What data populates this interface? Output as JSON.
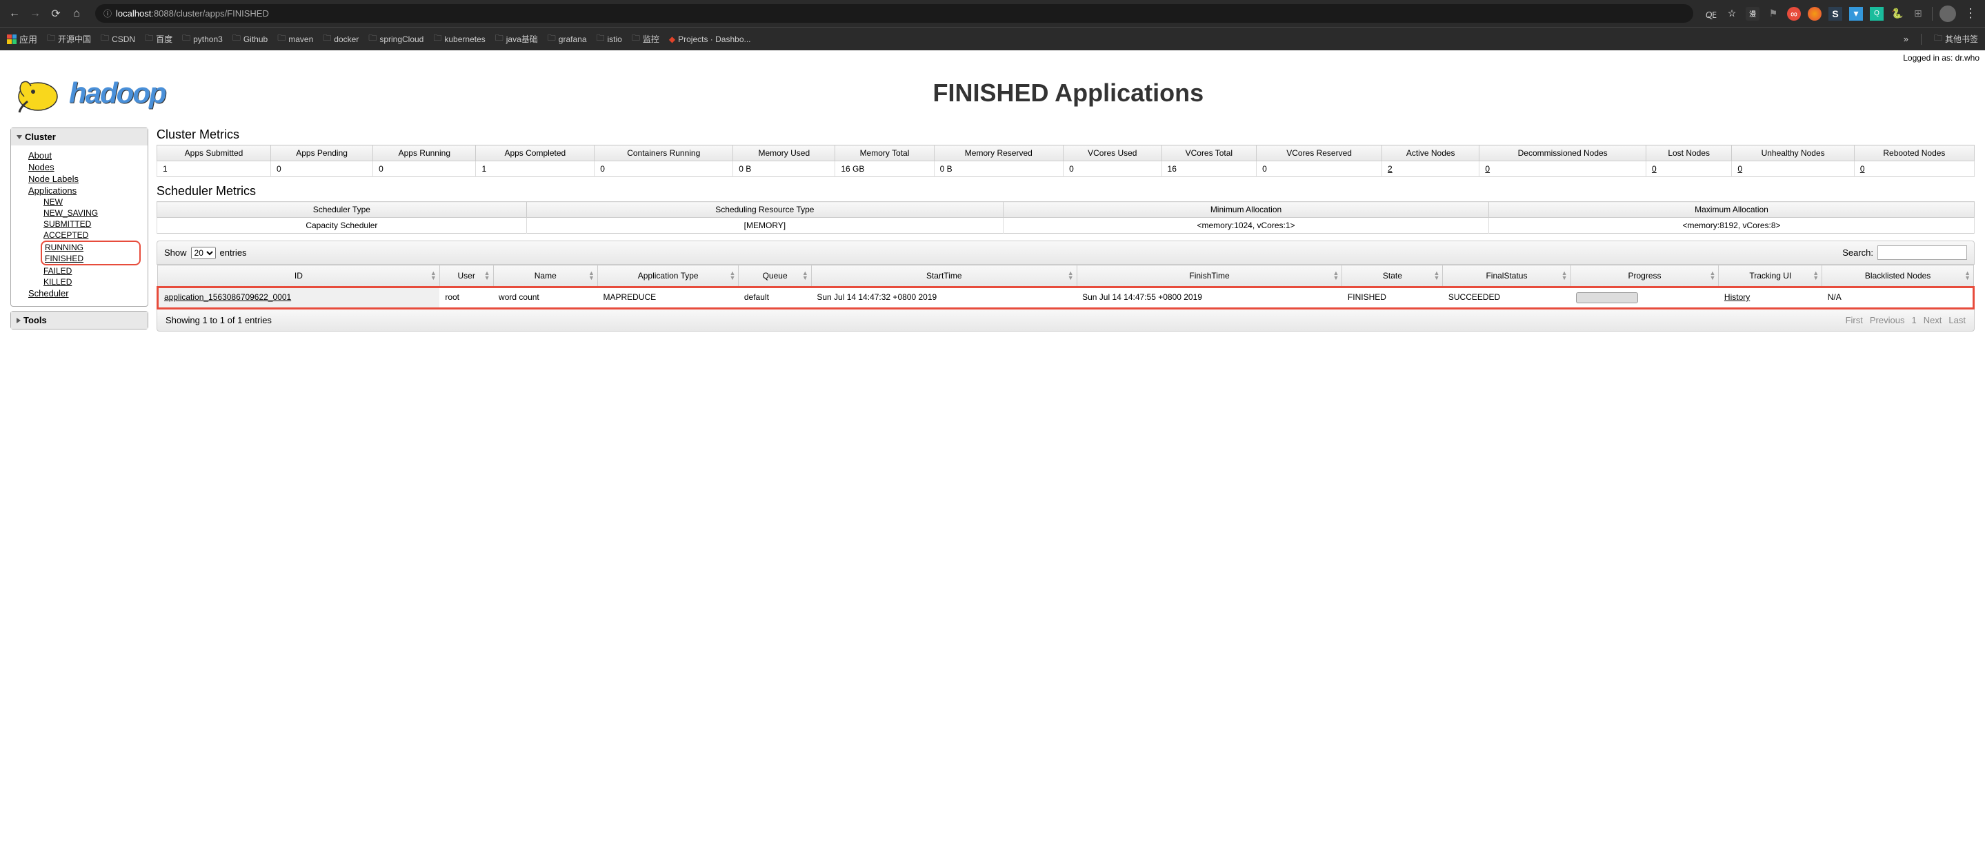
{
  "browser": {
    "url_prefix": "localhost",
    "url_path": ":8088/cluster/apps/FINISHED",
    "bookmarks_apps": "应用",
    "bookmarks": [
      "开源中国",
      "CSDN",
      "百度",
      "python3",
      "Github",
      "maven",
      "docker",
      "springCloud",
      "kubernetes",
      "java基础",
      "grafana",
      "istio",
      "监控"
    ],
    "bookmark_projects": "Projects · Dashbo...",
    "bookmark_other": "其他书签"
  },
  "page": {
    "login_label": "Logged in as: dr.who",
    "logo_text": "hadoop",
    "title": "FINISHED Applications"
  },
  "sidebar": {
    "cluster_header": "Cluster",
    "links": {
      "about": "About",
      "nodes": "Nodes",
      "node_labels": "Node Labels",
      "applications": "Applications",
      "scheduler": "Scheduler"
    },
    "app_states": [
      "NEW",
      "NEW_SAVING",
      "SUBMITTED",
      "ACCEPTED",
      "RUNNING",
      "FINISHED",
      "FAILED",
      "KILLED"
    ],
    "tools_header": "Tools"
  },
  "cluster_metrics": {
    "title": "Cluster Metrics",
    "headers": [
      "Apps Submitted",
      "Apps Pending",
      "Apps Running",
      "Apps Completed",
      "Containers Running",
      "Memory Used",
      "Memory Total",
      "Memory Reserved",
      "VCores Used",
      "VCores Total",
      "VCores Reserved",
      "Active Nodes",
      "Decommissioned Nodes",
      "Lost Nodes",
      "Unhealthy Nodes",
      "Rebooted Nodes"
    ],
    "values": [
      "1",
      "0",
      "0",
      "1",
      "0",
      "0 B",
      "16 GB",
      "0 B",
      "0",
      "16",
      "0",
      "2",
      "0",
      "0",
      "0",
      "0"
    ]
  },
  "scheduler_metrics": {
    "title": "Scheduler Metrics",
    "headers": [
      "Scheduler Type",
      "Scheduling Resource Type",
      "Minimum Allocation",
      "Maximum Allocation"
    ],
    "values": [
      "Capacity Scheduler",
      "[MEMORY]",
      "<memory:1024, vCores:1>",
      "<memory:8192, vCores:8>"
    ]
  },
  "apps_table": {
    "show_label": "Show",
    "show_value": "20",
    "entries_label": "entries",
    "search_label": "Search:",
    "headers": [
      "ID",
      "User",
      "Name",
      "Application Type",
      "Queue",
      "StartTime",
      "FinishTime",
      "State",
      "FinalStatus",
      "Progress",
      "Tracking UI",
      "Blacklisted Nodes"
    ],
    "row": {
      "id": "application_1563086709622_0001",
      "user": "root",
      "name": "word count",
      "type": "MAPREDUCE",
      "queue": "default",
      "start": "Sun Jul 14 14:47:32 +0800 2019",
      "finish": "Sun Jul 14 14:47:55 +0800 2019",
      "state": "FINISHED",
      "final": "SUCCEEDED",
      "tracking": "History",
      "blacklisted": "N/A"
    },
    "footer_info": "Showing 1 to 1 of 1 entries",
    "pagination": {
      "first": "First",
      "prev": "Previous",
      "page": "1",
      "next": "Next",
      "last": "Last"
    }
  }
}
